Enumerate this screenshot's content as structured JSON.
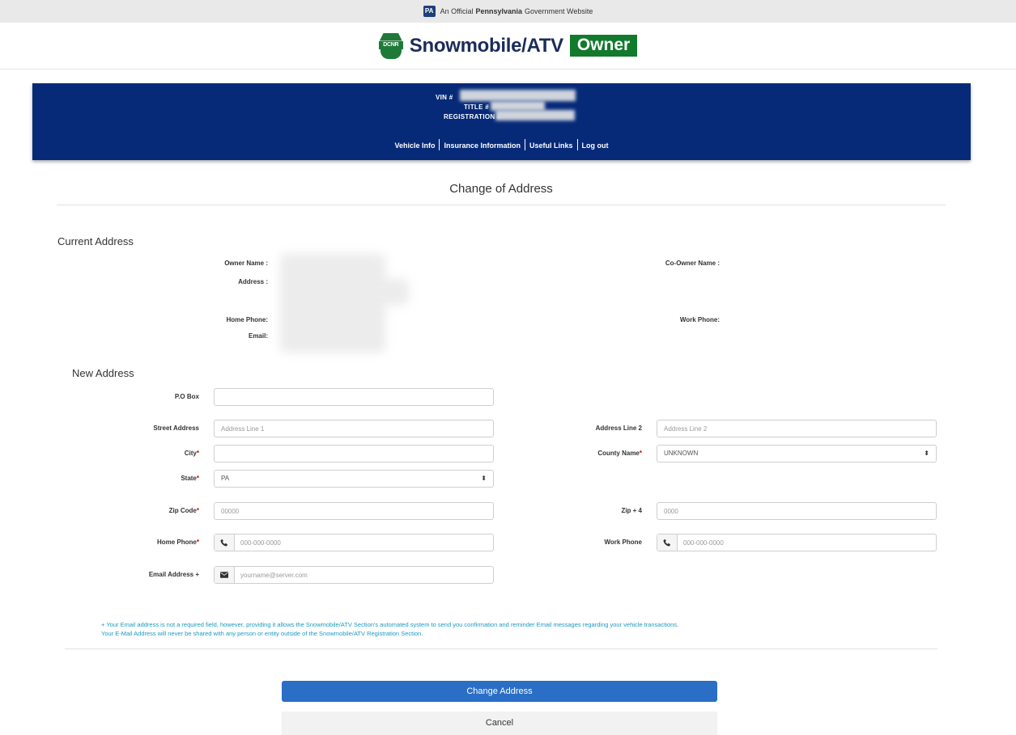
{
  "gov_banner": {
    "badge": "PA",
    "prefix": "An Official",
    "state": "Pennsylvania",
    "suffix": "Government Website"
  },
  "header": {
    "logo_text": "DCNR",
    "app_title": "Snowmobile/ATV",
    "badge": "Owner"
  },
  "vehicle_panel": {
    "vin_label": "VIN #",
    "title_label": "TITLE #",
    "registration_label": "REGISTRATION #",
    "nav": [
      "Vehicle Info",
      "Insurance Information",
      "Useful Links",
      "Log out"
    ]
  },
  "page_title": "Change of Address",
  "current_address": {
    "heading": "Current Address",
    "owner_name_label": "Owner Name :",
    "address_label": "Address :",
    "co_owner_label": "Co-Owner Name :",
    "home_phone_label": "Home Phone:",
    "email_label": "Email:",
    "work_phone_label": "Work Phone:"
  },
  "new_address": {
    "heading": "New Address",
    "po_box_label": "P.O Box",
    "street_label": "Street Address",
    "street_placeholder": "Address Line 1",
    "line2_label": "Address Line 2",
    "line2_placeholder": "Address Line 2",
    "city_label": "City",
    "county_label": "County Name",
    "county_value": "UNKNOWN",
    "state_label": "State",
    "state_value": "PA",
    "zip_label": "Zip Code",
    "zip_placeholder": "00000",
    "zip4_label": "Zip + 4",
    "zip4_placeholder": "0000",
    "home_phone_label": "Home Phone",
    "home_phone_placeholder": "000-000-0000",
    "work_phone_label": "Work Phone",
    "work_phone_placeholder": "000-000-0000",
    "email_label": "Email Address +",
    "email_placeholder": "yourname@server.com"
  },
  "required_marker": "*",
  "select_arrows": "⬍",
  "icons": {
    "phone": "phone-icon",
    "email": "envelope-icon"
  },
  "note": {
    "line1": "+ Your Email address is not a required field, however, providing it allows the Snowmobile/ATV Section's automated system to send you confirmation and reminder Email messages regarding your vehicle transactions.",
    "line2": "Your E-Mail Address will never be shared with any person or entity outside of the Snowmobile/ATV Registration Section."
  },
  "buttons": {
    "submit": "Change Address",
    "cancel": "Cancel"
  },
  "colors": {
    "panel": "#062a78",
    "brand_green": "#127a2c",
    "primary": "#2a6ec6",
    "note": "#1a9bbf",
    "required": "#cc0000"
  }
}
